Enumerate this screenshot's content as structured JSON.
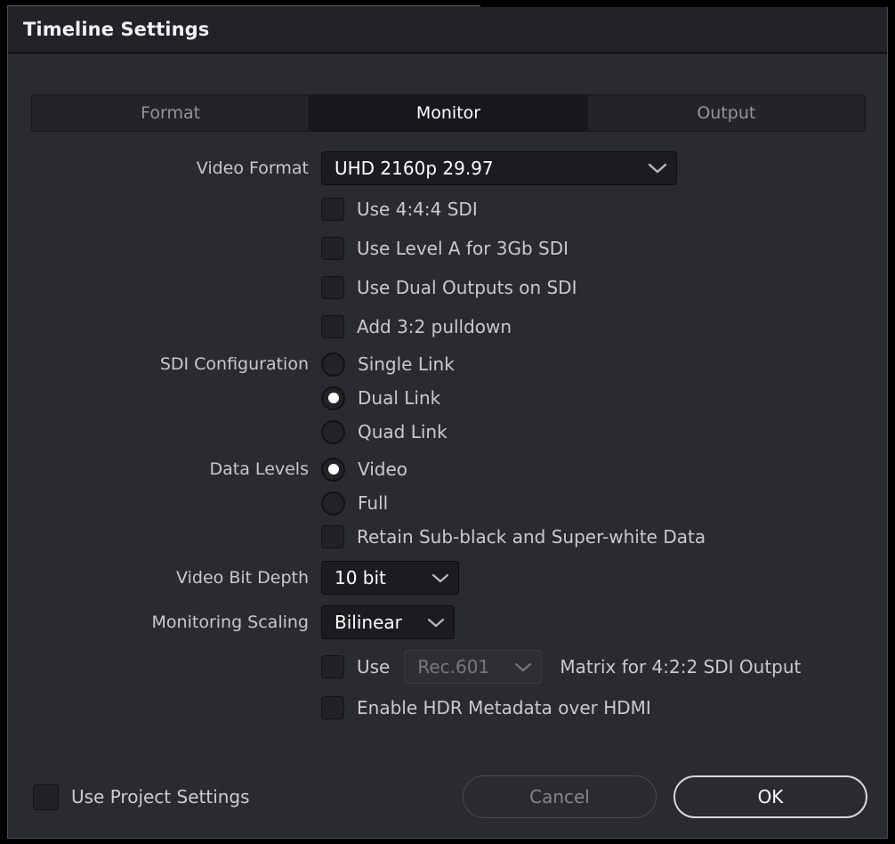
{
  "window": {
    "title": "Timeline Settings"
  },
  "tabs": [
    {
      "label": "Format",
      "selected": false
    },
    {
      "label": "Monitor",
      "selected": true
    },
    {
      "label": "Output",
      "selected": false
    }
  ],
  "form": {
    "video_format": {
      "label": "Video Format",
      "value": "UHD 2160p 29.97"
    },
    "sdi_checkboxes": [
      {
        "label": "Use 4:4:4 SDI",
        "checked": false
      },
      {
        "label": "Use Level A for 3Gb SDI",
        "checked": false
      },
      {
        "label": "Use Dual Outputs on SDI",
        "checked": false
      },
      {
        "label": "Add 3:2 pulldown",
        "checked": false
      }
    ],
    "sdi_configuration": {
      "label": "SDI Configuration",
      "options": [
        {
          "label": "Single Link",
          "selected": false
        },
        {
          "label": "Dual Link",
          "selected": true
        },
        {
          "label": "Quad Link",
          "selected": false
        }
      ]
    },
    "data_levels": {
      "label": "Data Levels",
      "options": [
        {
          "label": "Video",
          "selected": true
        },
        {
          "label": "Full",
          "selected": false
        }
      ],
      "retain_checkbox": {
        "label": "Retain Sub-black and Super-white Data",
        "checked": false
      }
    },
    "video_bit_depth": {
      "label": "Video Bit Depth",
      "value": "10 bit"
    },
    "monitoring_scaling": {
      "label": "Monitoring Scaling",
      "value": "Bilinear"
    },
    "matrix_row": {
      "checked": false,
      "use_word": "Use",
      "matrix_value": "Rec.601",
      "tail_text": "Matrix for 4:2:2 SDI Output"
    },
    "hdr_metadata": {
      "label": "Enable HDR Metadata over HDMI",
      "checked": false
    }
  },
  "footer": {
    "use_project_settings": {
      "label": "Use Project Settings",
      "checked": false
    },
    "cancel_label": "Cancel",
    "ok_label": "OK"
  },
  "colors": {
    "dialog_bg": "#2a2b31",
    "titlebar_bg": "#222227",
    "tab_bg": "#232328",
    "tab_selected_bg": "#18181c",
    "select_bg": "#1c1c20",
    "text_primary": "#ffffff",
    "text_secondary": "#c9c9ce",
    "text_muted": "#85858c",
    "ok_border": "#d8d8dc"
  }
}
